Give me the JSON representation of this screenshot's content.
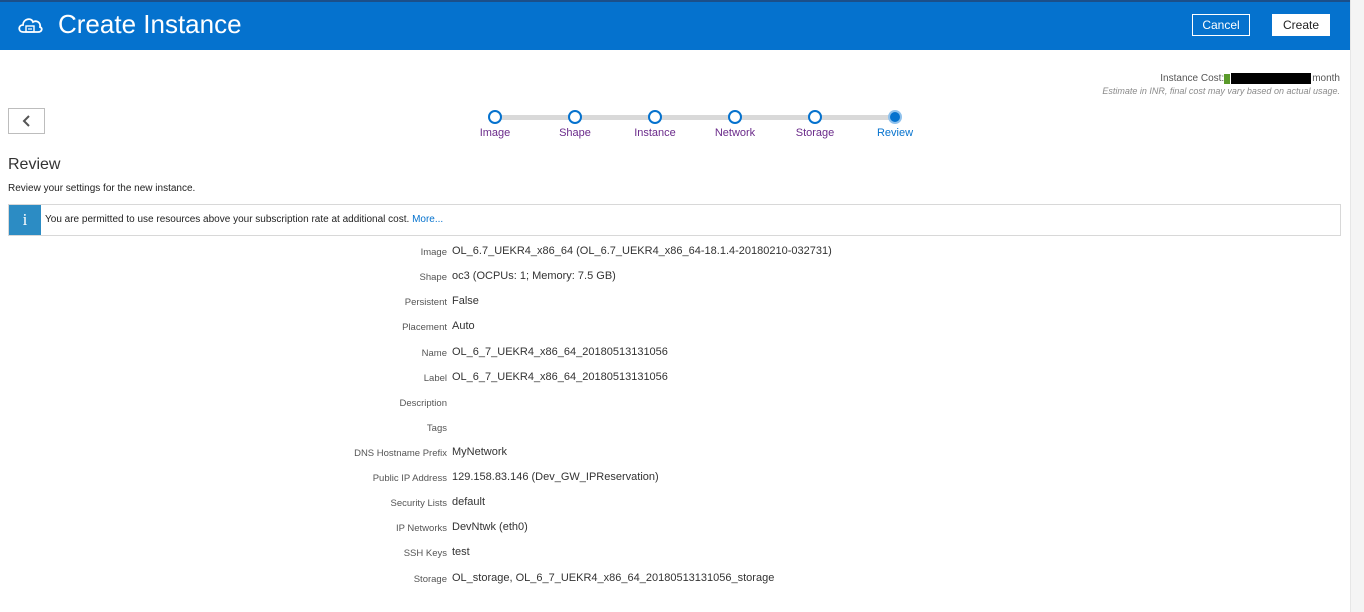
{
  "header": {
    "title": "Create Instance",
    "cancel_label": "Cancel",
    "create_label": "Create",
    "icon": "cloud-icon"
  },
  "cost": {
    "label": "Instance Cost:",
    "suffix": "month",
    "estimate": "Estimate in INR, final cost may vary based on actual usage."
  },
  "back_icon": "chevron-left-icon",
  "train": {
    "steps": [
      {
        "label": "Image"
      },
      {
        "label": "Shape"
      },
      {
        "label": "Instance"
      },
      {
        "label": "Network"
      },
      {
        "label": "Storage"
      },
      {
        "label": "Review"
      }
    ],
    "current": "Review"
  },
  "review": {
    "title": "Review",
    "subtitle": "Review your settings for the new instance."
  },
  "info": {
    "icon": "info-icon",
    "icon_glyph": "i",
    "text": "You are permitted to use resources above your subscription rate at additional cost.",
    "link": "More..."
  },
  "details": [
    {
      "key": "Image",
      "value": "OL_6.7_UEKR4_x86_64 (OL_6.7_UEKR4_x86_64-18.1.4-20180210-032731)"
    },
    {
      "key": "Shape",
      "value": "oc3 (OCPUs: 1; Memory: 7.5 GB)"
    },
    {
      "key": "Persistent",
      "value": "False"
    },
    {
      "key": "Placement",
      "value": "Auto"
    },
    {
      "key": "Name",
      "value": "OL_6_7_UEKR4_x86_64_20180513131056"
    },
    {
      "key": "Label",
      "value": "OL_6_7_UEKR4_x86_64_20180513131056"
    },
    {
      "key": "Description",
      "value": ""
    },
    {
      "key": "Tags",
      "value": ""
    },
    {
      "key": "DNS Hostname Prefix",
      "value": "MyNetwork"
    },
    {
      "key": "Public IP Address",
      "value": "129.158.83.146 (Dev_GW_IPReservation)"
    },
    {
      "key": "Security Lists",
      "value": "default"
    },
    {
      "key": "IP Networks",
      "value": " DevNtwk (eth0)"
    },
    {
      "key": "SSH Keys",
      "value": "test"
    },
    {
      "key": "Storage",
      "value": "OL_storage, OL_6_7_UEKR4_x86_64_20180513131056_storage"
    }
  ],
  "colors": {
    "header_bg": "#0572ce",
    "step_label": "#6a2a8a",
    "link": "#0572ce",
    "info_icon_bg": "#2c8cc4"
  }
}
